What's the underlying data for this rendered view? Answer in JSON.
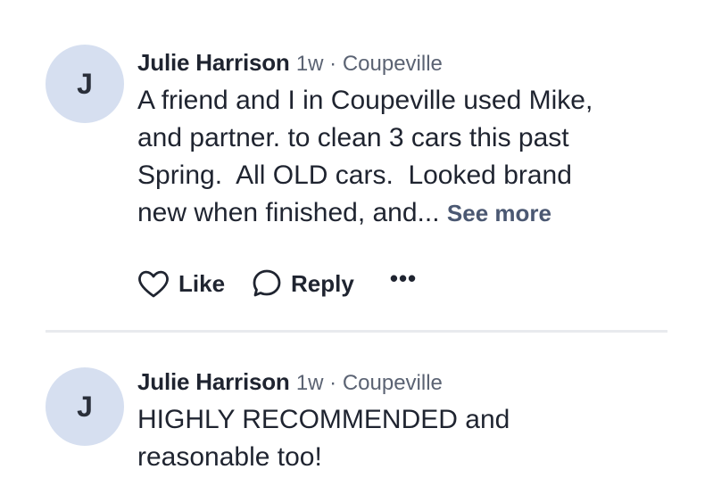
{
  "comments": [
    {
      "avatar_initial": "J",
      "author": "Julie Harrison",
      "meta": "1w · Coupeville",
      "text": "A friend and I in Coupeville used Mike,\nand partner. to clean 3 cars this past\nSpring.  All OLD cars.  Looked brand\nnew when finished, and... ",
      "see_more": "See more",
      "like_label": "Like",
      "reply_label": "Reply",
      "more_label": "•••"
    },
    {
      "avatar_initial": "J",
      "author": "Julie Harrison",
      "meta": "1w · Coupeville",
      "text": "HIGHLY RECOMMENDED and\nreasonable too!"
    }
  ]
}
